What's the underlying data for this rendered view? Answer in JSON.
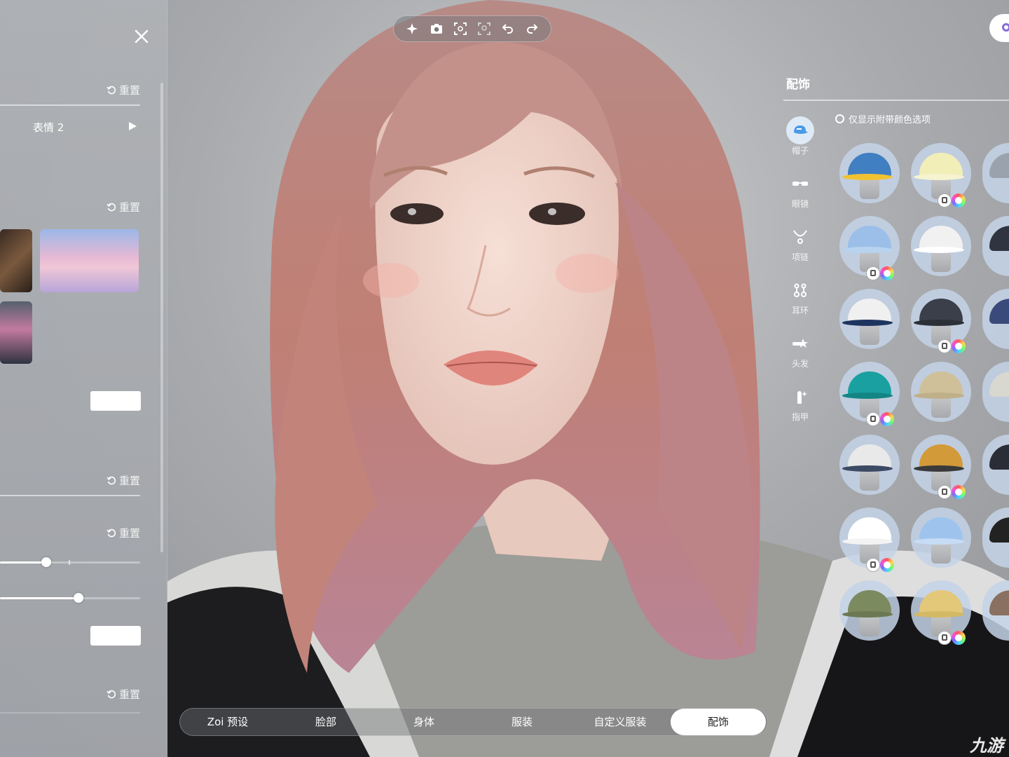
{
  "left_panel": {
    "reset_label": "重置",
    "expression_label": "表情 2"
  },
  "right_panel": {
    "title": "配饰",
    "color_only_label": "仅显示附带颜色选项",
    "categories": [
      {
        "label": "帽子",
        "icon": "hat-icon",
        "active": true
      },
      {
        "label": "眼镜",
        "icon": "glasses-icon",
        "active": false
      },
      {
        "label": "项链",
        "icon": "necklace-icon",
        "active": false
      },
      {
        "label": "耳环",
        "icon": "earring-icon",
        "active": false
      },
      {
        "label": "头发",
        "icon": "hair-clip-icon",
        "active": false
      },
      {
        "label": "指甲",
        "icon": "nail-icon",
        "active": false
      }
    ],
    "items": [
      {
        "hat": "#3f7fc2",
        "brim": "#f1c232",
        "badges": false
      },
      {
        "hat": "#f2eeb8",
        "brim": "#f6f3d0",
        "badges": true
      },
      {
        "hat": "#9bbfe8",
        "brim": "#b7d3f0",
        "badges": true
      },
      {
        "hat": "#f1f1f1",
        "brim": "#ffffff",
        "badges": false
      },
      {
        "hat": "#f0f0f0",
        "brim": "#1e3460",
        "badges": false
      },
      {
        "hat": "#3a3f4a",
        "brim": "#2b2f37",
        "badges": true
      },
      {
        "hat": "#1aa0a0",
        "brim": "#138585",
        "badges": true
      },
      {
        "hat": "#cfc09a",
        "brim": "#bfb08a",
        "badges": false
      },
      {
        "hat": "#e9e9e9",
        "brim": "#3d4a66",
        "badges": false
      },
      {
        "hat": "#d39a3a",
        "brim": "#3a3a3a",
        "badges": true
      },
      {
        "hat": "#ffffff",
        "brim": "#f3f3f3",
        "badges": true
      },
      {
        "hat": "#9ec4ee",
        "brim": "#c7dcf5",
        "badges": false
      },
      {
        "hat": "#7c8a60",
        "brim": "#6b7852",
        "badges": false
      },
      {
        "hat": "#e2c878",
        "brim": "#d4b965",
        "badges": true
      }
    ]
  },
  "sliders": [
    {
      "value": 0.33
    },
    {
      "value": 0.56
    }
  ],
  "tabs": [
    {
      "label": "Zoi 预设",
      "active": false
    },
    {
      "label": "脸部",
      "active": false
    },
    {
      "label": "身体",
      "active": false
    },
    {
      "label": "服装",
      "active": false
    },
    {
      "label": "自定义服装",
      "active": false
    },
    {
      "label": "配饰",
      "active": true
    }
  ],
  "toolbar": [
    "sparkle-icon",
    "camera-icon",
    "focus-frame-icon",
    "face-scan-icon",
    "undo-icon",
    "redo-icon"
  ],
  "watermark": "九游"
}
